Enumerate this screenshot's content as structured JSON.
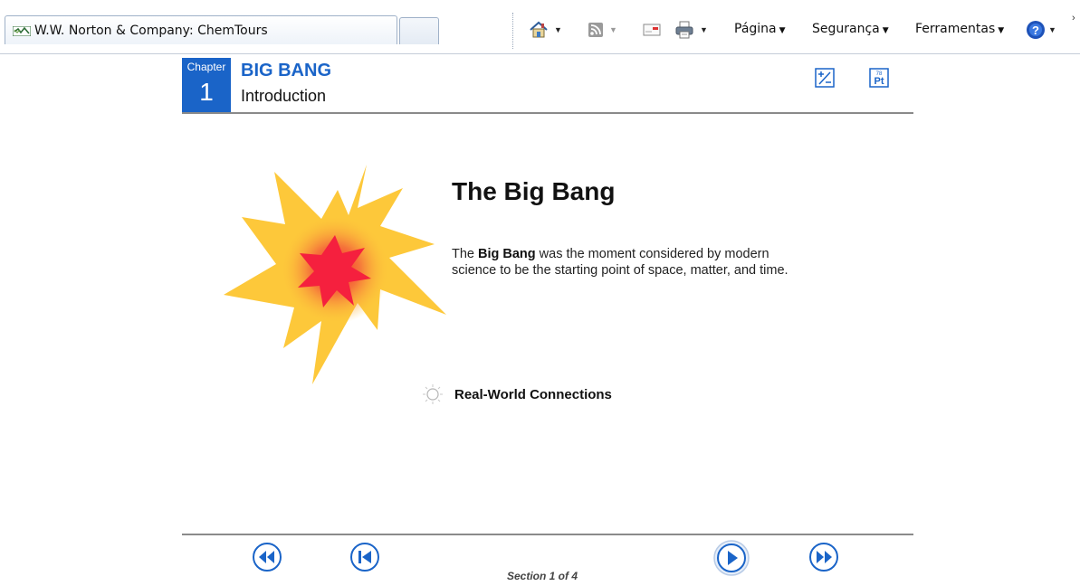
{
  "browser": {
    "tab_title": "W.W. Norton & Company: ChemTours",
    "commands": {
      "page": "Página",
      "security": "Segurança",
      "tools": "Ferramentas"
    },
    "icons": [
      "home-icon",
      "rss-feed-icon",
      "read-mail-icon",
      "print-icon",
      "help-icon"
    ]
  },
  "chapter": {
    "label": "Chapter",
    "number": "1",
    "title": "BIG BANG",
    "subtitle": "Introduction",
    "tools": [
      "calculator-icon",
      "periodic-table-icon"
    ]
  },
  "content": {
    "heading": "The Big Bang",
    "body_prefix": "The ",
    "body_bold": "Big Bang",
    "body_suffix": " was the moment considered by modern science to be the starting point of space, matter, and time.",
    "real_world_label": "Real-World Connections"
  },
  "footer": {
    "section_text": "Section 1 of 4",
    "buttons": [
      "rewind-icon",
      "first-section-icon",
      "play-icon",
      "fast-forward-icon"
    ]
  },
  "colors": {
    "accent_blue": "#1a64c8",
    "burst_yellow": "#fdc83a",
    "burst_red": "#f5203e"
  }
}
